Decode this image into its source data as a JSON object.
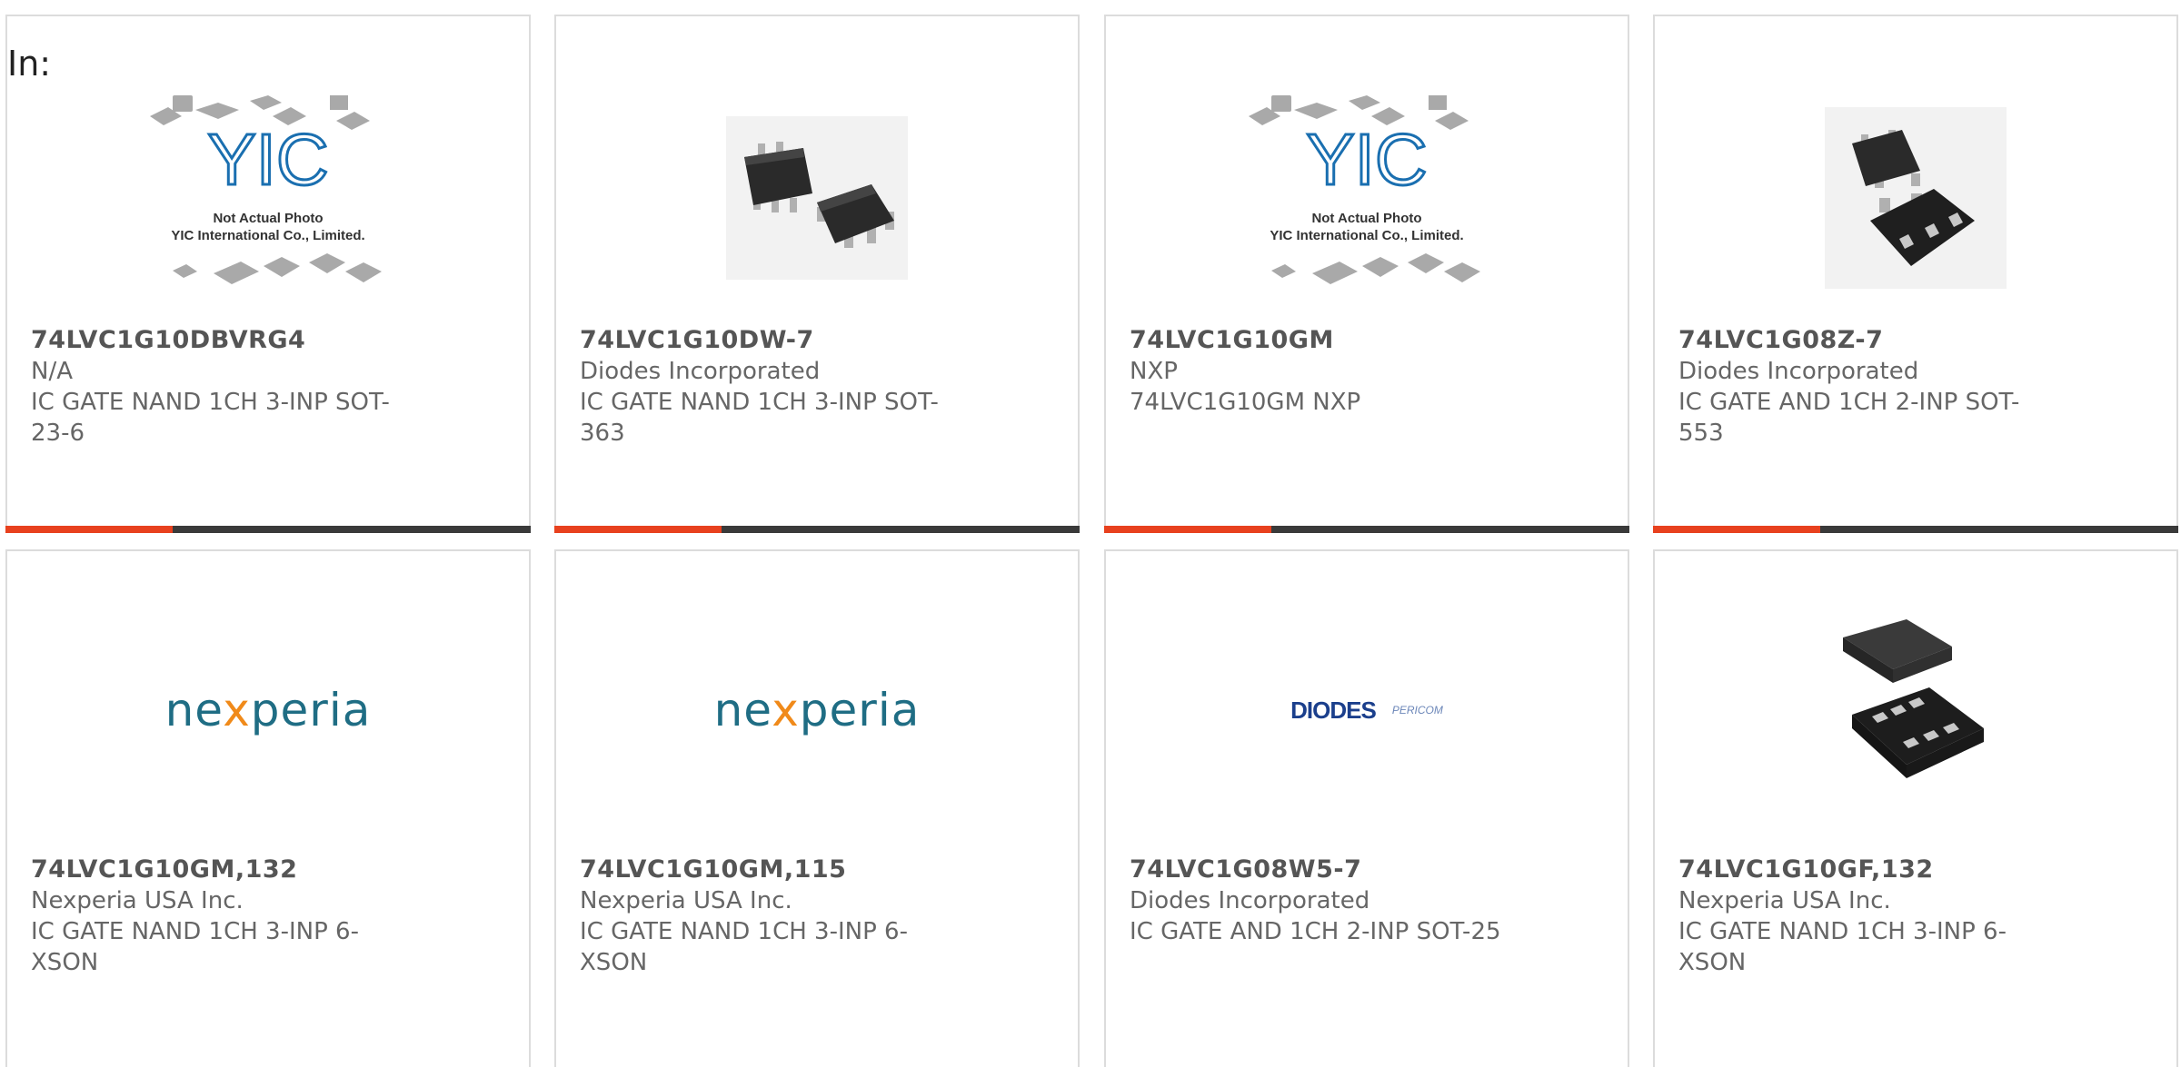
{
  "page_label": "In:",
  "colors": {
    "accent": "#e8411e",
    "bar": "#3a3a3a",
    "border": "#dcdcdc"
  },
  "products": [
    {
      "part": "74LVC1G10DBVRG4",
      "manufacturer": "N/A",
      "description": "IC GATE NAND 1CH 3-INP SOT-23-6",
      "image": "yic-placeholder",
      "caption_line1": "Not Actual Photo",
      "caption_line2": "YIC International Co., Limited."
    },
    {
      "part": "74LVC1G10DW-7",
      "manufacturer": "Diodes Incorporated",
      "description": "IC GATE NAND 1CH 3-INP SOT-363",
      "image": "sot363-chip"
    },
    {
      "part": "74LVC1G10GM",
      "manufacturer": "NXP",
      "description": "74LVC1G10GM NXP",
      "image": "yic-placeholder",
      "caption_line1": "Not Actual Photo",
      "caption_line2": "YIC International Co., Limited."
    },
    {
      "part": "74LVC1G08Z-7",
      "manufacturer": "Diodes Incorporated",
      "description": "IC GATE AND 1CH 2-INP SOT-553",
      "image": "sot553-chip"
    },
    {
      "part": "74LVC1G10GM,132",
      "manufacturer": "Nexperia USA Inc.",
      "description": "IC GATE NAND 1CH 3-INP 6-XSON",
      "image": "nexperia-logo",
      "logo_text_a": "ne",
      "logo_text_x": "x",
      "logo_text_b": "peria"
    },
    {
      "part": "74LVC1G10GM,115",
      "manufacturer": "Nexperia USA Inc.",
      "description": "IC GATE NAND 1CH 3-INP 6-XSON",
      "image": "nexperia-logo",
      "logo_text_a": "ne",
      "logo_text_x": "x",
      "logo_text_b": "peria"
    },
    {
      "part": "74LVC1G08W5-7",
      "manufacturer": "Diodes Incorporated",
      "description": "IC GATE AND 1CH 2-INP SOT-25",
      "image": "diodes-pericom-logo",
      "logo_text_a": "DIODES",
      "logo_text_b": "PERICOM"
    },
    {
      "part": "74LVC1G10GF,132",
      "manufacturer": "Nexperia USA Inc.",
      "description": "IC GATE NAND 1CH 3-INP 6-XSON",
      "image": "xson6-chip"
    }
  ]
}
